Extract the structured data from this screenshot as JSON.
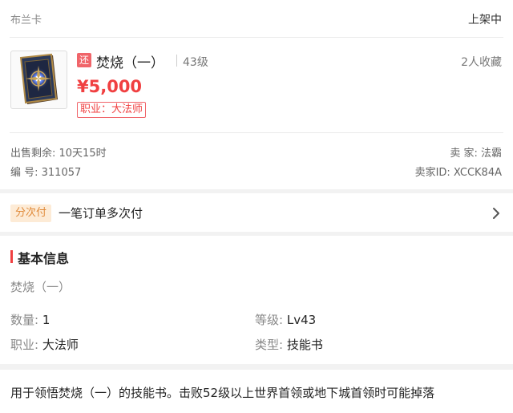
{
  "header": {
    "server": "布兰卡",
    "status": "上架中"
  },
  "item": {
    "badge": "还",
    "name": "焚烧（一）",
    "level": "43级",
    "favorites": "2人收藏",
    "price": "¥5,000",
    "job_tag": "职业：大法师"
  },
  "meta": {
    "remain": "出售剩余: 10天15时",
    "seller": "卖 家: 法霸",
    "serial": "编 号: 311057",
    "seller_id": "卖家ID: XCCK84A"
  },
  "payment": {
    "tag": "分次付",
    "text": "一笔订单多次付"
  },
  "basic": {
    "title": "基本信息",
    "name": "焚烧（一）",
    "rows": [
      {
        "key": "数量:",
        "value": "1"
      },
      {
        "key": "等级:",
        "value": "Lv43"
      },
      {
        "key": "职业:",
        "value": "大法师"
      },
      {
        "key": "类型:",
        "value": "技能书"
      }
    ]
  },
  "description": "用于领悟焚烧（一）的技能书。击败52级以上世界首领或地下城首领时可能掉落",
  "colors": {
    "accent": "#f04041",
    "pay_tag_bg": "#fdebd6",
    "pay_tag_fg": "#e08a3a"
  },
  "icons": {
    "item": "spellbook-icon",
    "arrow": "chevron-right-icon"
  }
}
